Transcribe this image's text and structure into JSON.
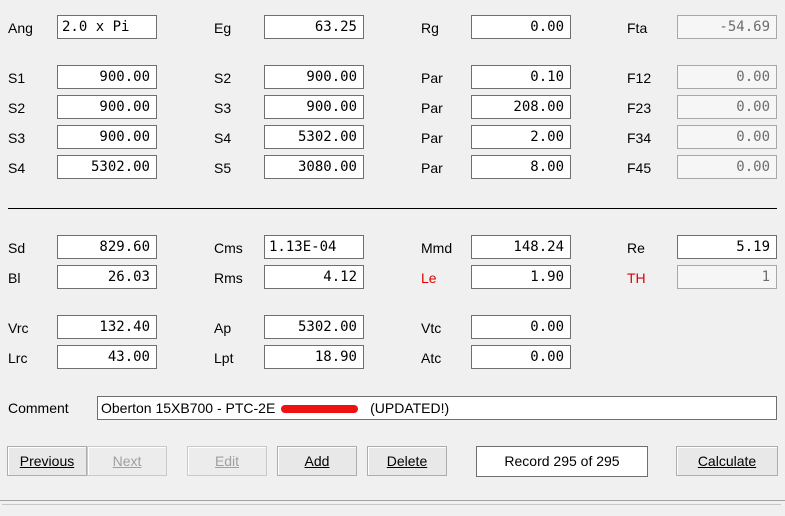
{
  "top": {
    "ang_label": "Ang",
    "ang_value": "2.0 x Pi",
    "eg_label": "Eg",
    "eg_value": "63.25",
    "rg_label": "Rg",
    "rg_value": "0.00",
    "fta_label": "Fta",
    "fta_value": "-54.69"
  },
  "segments": [
    {
      "l1": "S1",
      "v1": "900.00",
      "l2": "S2",
      "v2": "900.00",
      "l3": "Par",
      "v3": "0.10",
      "l4": "F12",
      "v4": "0.00"
    },
    {
      "l1": "S2",
      "v1": "900.00",
      "l2": "S3",
      "v2": "900.00",
      "l3": "Par",
      "v3": "208.00",
      "l4": "F23",
      "v4": "0.00"
    },
    {
      "l1": "S3",
      "v1": "900.00",
      "l2": "S4",
      "v2": "5302.00",
      "l3": "Par",
      "v3": "2.00",
      "l4": "F34",
      "v4": "0.00"
    },
    {
      "l1": "S4",
      "v1": "5302.00",
      "l2": "S5",
      "v2": "3080.00",
      "l3": "Par",
      "v3": "8.00",
      "l4": "F45",
      "v4": "0.00"
    }
  ],
  "driver": {
    "sd_label": "Sd",
    "sd_value": "829.60",
    "cms_label": "Cms",
    "cms_value": "1.13E-04",
    "mmd_label": "Mmd",
    "mmd_value": "148.24",
    "re_label": "Re",
    "re_value": "5.19",
    "bl_label": "Bl",
    "bl_value": "26.03",
    "rms_label": "Rms",
    "rms_value": "4.12",
    "le_label": "Le",
    "le_value": "1.90",
    "th_label": "TH",
    "th_value": "1"
  },
  "port": {
    "vrc_label": "Vrc",
    "vrc_value": "132.40",
    "ap_label": "Ap",
    "ap_value": "5302.00",
    "vtc_label": "Vtc",
    "vtc_value": "0.00",
    "lrc_label": "Lrc",
    "lrc_value": "43.00",
    "lpt_label": "Lpt",
    "lpt_value": "18.90",
    "atc_label": "Atc",
    "atc_value": "0.00"
  },
  "comment": {
    "label": "Comment",
    "text_before": "Oberton 15XB700 -  PTC-2E",
    "text_after": "(UPDATED!)"
  },
  "buttons": {
    "previous": "Previous",
    "next": "Next",
    "edit": "Edit",
    "add": "Add",
    "delete": "Delete",
    "calculate": "Calculate"
  },
  "record": "Record 295 of 295",
  "colors": {
    "red_label": "#e00000",
    "redaction": "#ee1111"
  }
}
